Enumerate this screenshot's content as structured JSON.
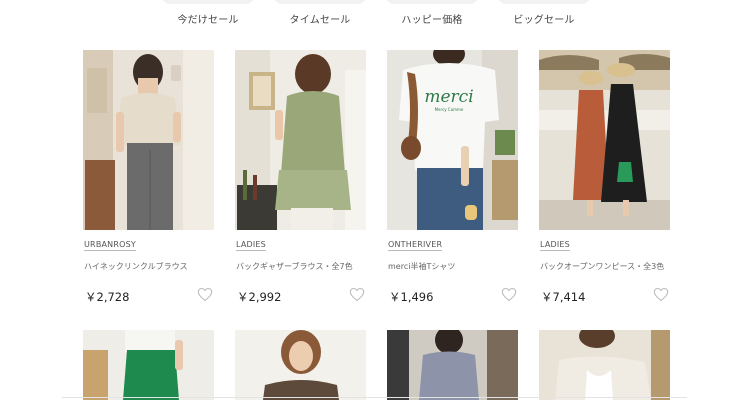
{
  "tabs": [
    {
      "label": "今だけセール"
    },
    {
      "label": "タイムセール"
    },
    {
      "label": "ハッピー価格"
    },
    {
      "label": "ビッグセール"
    }
  ],
  "products": [
    {
      "brand": "URBANROSY",
      "name": "ハイネックリンクルブラウス",
      "price": "￥2,728",
      "heart_icon": "heart-outline-icon"
    },
    {
      "brand": "LADIES",
      "name": "バックギャザーブラウス・全7色",
      "price": "￥2,992",
      "heart_icon": "heart-outline-icon"
    },
    {
      "brand": "ONTHERIVER",
      "name": "merci半袖Tシャツ",
      "price": "￥1,496",
      "heart_icon": "heart-outline-icon"
    },
    {
      "brand": "LADIES",
      "name": "バックオープンワンピース・全3色",
      "price": "￥7,414",
      "heart_icon": "heart-outline-icon"
    }
  ],
  "tshirt_print": {
    "main": "merci",
    "sub": "Mercy Comme"
  },
  "colors": {
    "heart": "#bbbbbb",
    "tab_bg": "#f2f2f2"
  }
}
